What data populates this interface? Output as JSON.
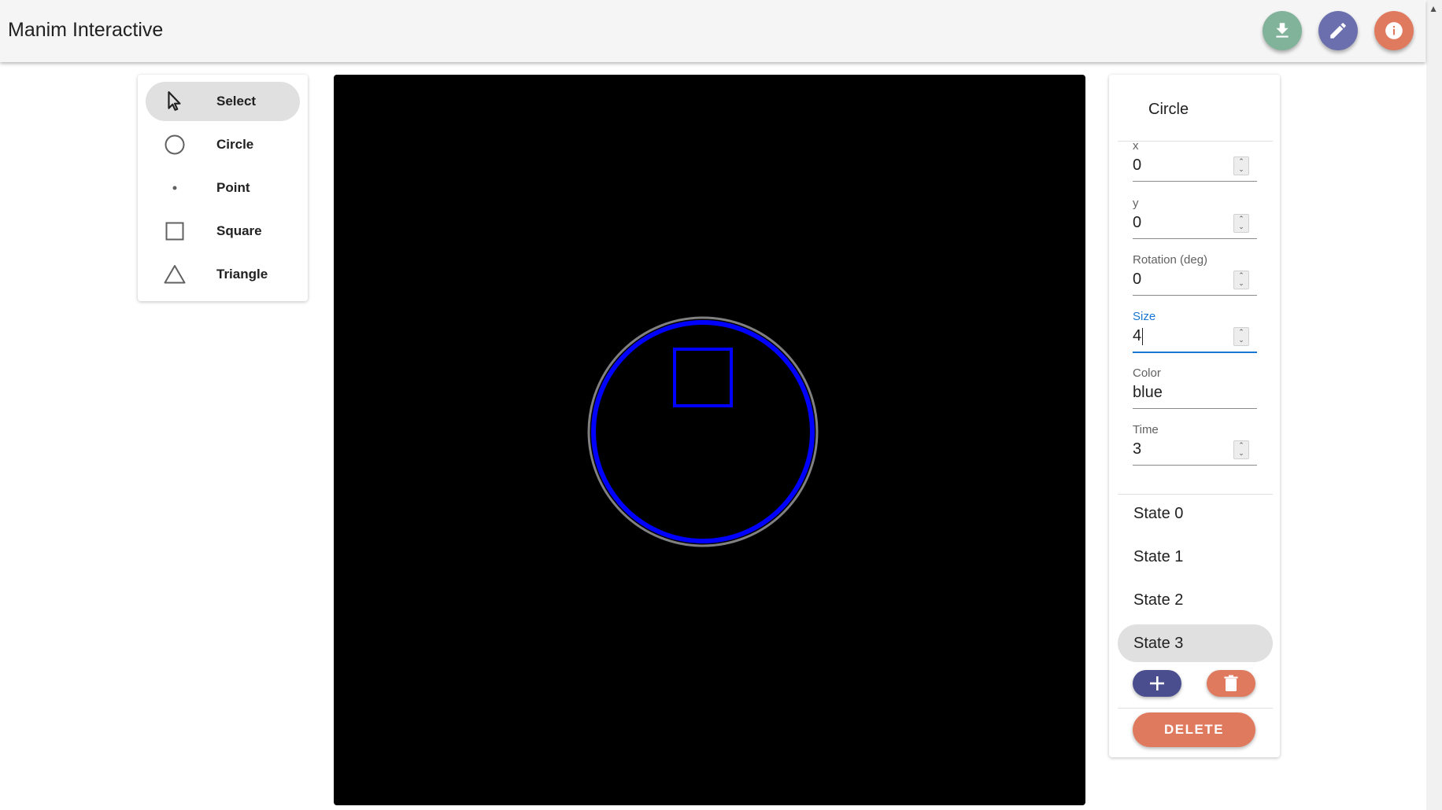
{
  "app": {
    "title": "Manim Interactive"
  },
  "header_actions": [
    {
      "name": "download-button",
      "icon": "download-icon",
      "color": "#81b29a"
    },
    {
      "name": "edit-button",
      "icon": "pencil-icon",
      "color": "#6c6fae"
    },
    {
      "name": "info-button",
      "icon": "info-icon",
      "color": "#e07a5f"
    }
  ],
  "tools": {
    "items": [
      {
        "label": "Select",
        "icon": "cursor-arrow-icon",
        "active": true
      },
      {
        "label": "Circle",
        "icon": "circle-icon",
        "active": false
      },
      {
        "label": "Point",
        "icon": "point-icon",
        "active": false
      },
      {
        "label": "Square",
        "icon": "square-icon",
        "active": false
      },
      {
        "label": "Triangle",
        "icon": "triangle-icon",
        "active": false
      }
    ]
  },
  "canvas": {
    "background": "#000000",
    "shapes": [
      {
        "type": "circle",
        "stroke": "#0000ff",
        "outline": "#808080"
      },
      {
        "type": "square",
        "stroke": "#0000ff"
      }
    ]
  },
  "properties": {
    "title": "Circle",
    "fields": {
      "x": {
        "label": "x",
        "value": "0"
      },
      "y": {
        "label": "y",
        "value": "0"
      },
      "rotation": {
        "label": "Rotation (deg)",
        "value": "0"
      },
      "size": {
        "label": "Size",
        "value": "4",
        "focused": true
      },
      "color": {
        "label": "Color",
        "value": "blue"
      },
      "time": {
        "label": "Time",
        "value": "3"
      }
    },
    "states": [
      {
        "label": "State 0",
        "active": false
      },
      {
        "label": "State 1",
        "active": false
      },
      {
        "label": "State 2",
        "active": false
      },
      {
        "label": "State 3",
        "active": true
      }
    ],
    "add_state_color": "#4a4e8f",
    "remove_state_color": "#e07a5f",
    "delete_label": "DELETE",
    "focus_color": "#1976d2"
  }
}
